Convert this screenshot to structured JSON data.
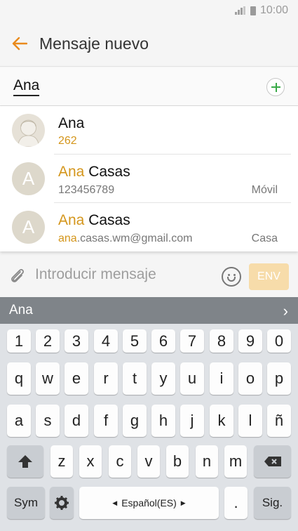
{
  "status_bar": {
    "time": "10:00"
  },
  "app_bar": {
    "title": "Mensaje nuevo"
  },
  "recipient": {
    "text": "Ana"
  },
  "suggestions": [
    {
      "name_match": "Ana",
      "name_rest": "",
      "detail_match": "",
      "detail_rest": "262",
      "type": "",
      "avatar": "photo",
      "detail_highlight_all": true
    },
    {
      "name_match": "Ana",
      "name_rest": " Casas",
      "detail_match": "",
      "detail_rest": "123456789",
      "type": "Móvil",
      "avatar": "A"
    },
    {
      "name_match": "Ana",
      "name_rest": " Casas",
      "detail_match": "ana",
      "detail_rest": ".casas.wm@gmail.com",
      "type": "Casa",
      "avatar": "A"
    }
  ],
  "compose": {
    "placeholder": "Introducir mensaje",
    "send_label": "ENV"
  },
  "keyboard": {
    "prediction": "Ana",
    "row_numbers": [
      "1",
      "2",
      "3",
      "4",
      "5",
      "6",
      "7",
      "8",
      "9",
      "0"
    ],
    "row_1": [
      "q",
      "w",
      "e",
      "r",
      "t",
      "y",
      "u",
      "i",
      "o",
      "p"
    ],
    "row_2": [
      "a",
      "s",
      "d",
      "f",
      "g",
      "h",
      "j",
      "k",
      "l",
      "ñ"
    ],
    "row_3": [
      "z",
      "x",
      "c",
      "v",
      "b",
      "n",
      "m"
    ],
    "sym_label": "Sym",
    "space_label": "Español(ES)",
    "period_label": ".",
    "next_label": "Sig."
  },
  "colors": {
    "accent": "#d4961c",
    "add_green": "#3aaa48",
    "send_disabled": "#f7dcaa"
  },
  "icons": [
    "back-arrow-icon",
    "add-icon",
    "attach-icon",
    "emoji-icon",
    "shift-icon",
    "backspace-icon",
    "settings-icon",
    "chevron-right-icon"
  ]
}
